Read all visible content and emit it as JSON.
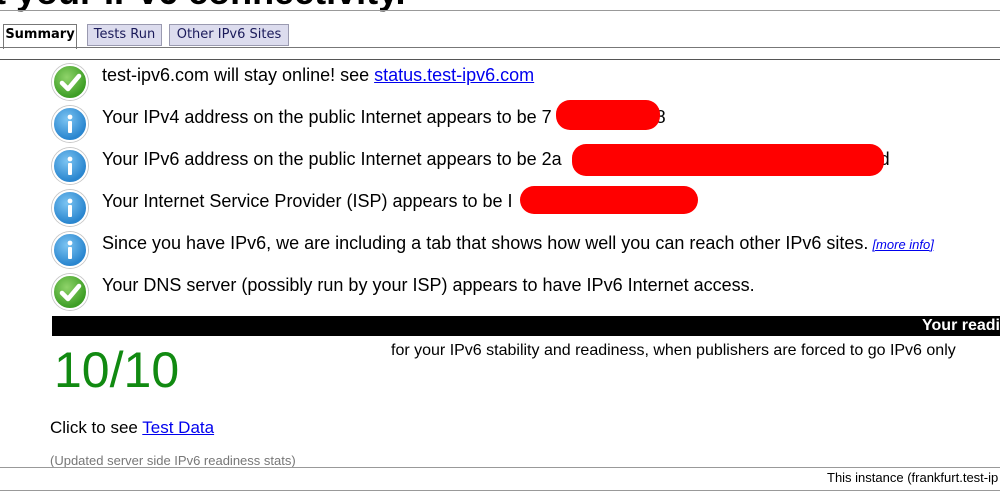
{
  "page": {
    "heading": "t your IPv6 connectivity."
  },
  "tabs": [
    {
      "label": "Summary",
      "active": true
    },
    {
      "label": "Tests Run",
      "active": false
    },
    {
      "label": "Other IPv6 Sites",
      "active": false
    }
  ],
  "results": [
    {
      "icon": "check-icon",
      "text": "test-ipv6.com will stay online! see ",
      "link": "status.test-ipv6.com"
    },
    {
      "icon": "info-icon",
      "text": "Your IPv4 address on the public Internet appears to be 7",
      "tail": "8"
    },
    {
      "icon": "info-icon",
      "text": "Your IPv6 address on the public Internet appears to be 2a",
      "tail": "3d"
    },
    {
      "icon": "info-icon",
      "text": "Your Internet Service Provider (ISP) appears to be I"
    },
    {
      "icon": "info-icon",
      "text": "Since you have IPv6, we are including a tab that shows how well you can reach other IPv6 sites.",
      "link": "[more info]"
    },
    {
      "icon": "check-icon",
      "text": "Your DNS server (possibly run by your ISP) appears to have IPv6 Internet access."
    }
  ],
  "score": {
    "bar_title": "Your readi",
    "value": "10/10",
    "description": "for your IPv6 stability and readiness, when publishers are forced to go IPv6 only"
  },
  "test_data": {
    "prefix": "Click to see ",
    "link": "Test Data"
  },
  "updated_note": "(Updated server side IPv6 readiness stats)",
  "footer": {
    "instance": "This instance (frankfurt.test-ip"
  },
  "colors": {
    "score_green": "#118a11",
    "info_blue": "#2a86cf",
    "ok_green": "#3e9e25",
    "redaction": "#ff0000"
  }
}
